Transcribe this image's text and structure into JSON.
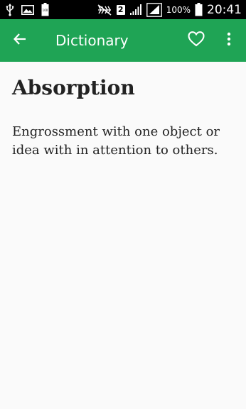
{
  "status_bar": {
    "icons": [
      "usb-icon",
      "image-icon",
      "battery-100-icon",
      "mute-icon",
      "sim-icon",
      "signal-icon",
      "signal-icon"
    ],
    "sim_label": "2",
    "battery_percent": "100%",
    "time": "20:41"
  },
  "app_bar": {
    "title": "Dictionary",
    "back_icon": "arrow-back-icon",
    "favorite_icon": "heart-outline-icon",
    "menu_icon": "more-vert-icon",
    "color": "#1fa455"
  },
  "entry": {
    "word": "Absorption",
    "definition": "Engrossment with one object or idea with in attention to others."
  }
}
